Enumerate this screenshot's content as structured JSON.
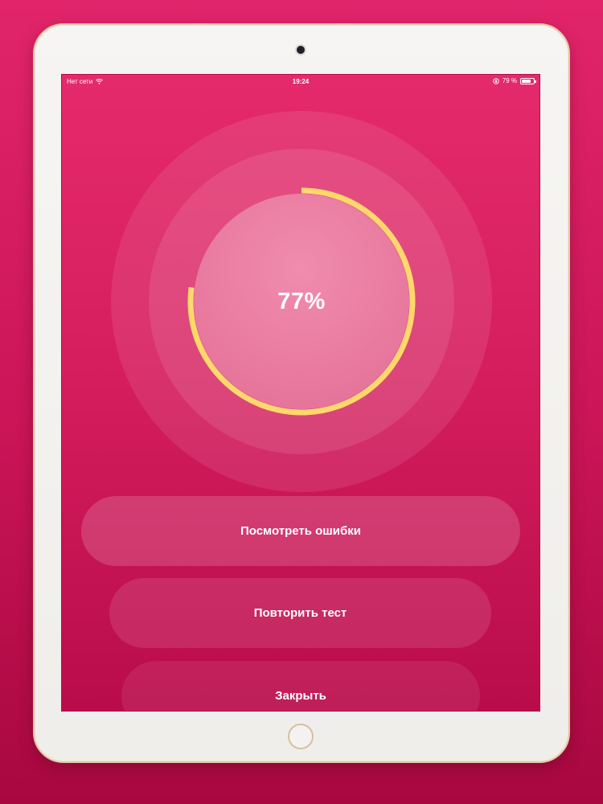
{
  "status_bar": {
    "carrier": "Нет сети",
    "time": "19:24",
    "battery_text": "79 %",
    "battery_level": 0.79,
    "icons": [
      "wifi-icon",
      "orientation-lock-icon",
      "battery-icon"
    ]
  },
  "result": {
    "percent_label": "77%",
    "progress": 0.77,
    "ring_color": "#ffd86b"
  },
  "actions": {
    "review_errors": "Посмотреть ошибки",
    "retry_test": "Повторить тест",
    "close": "Закрыть"
  },
  "colors": {
    "background": "#d61e5e",
    "accent": "#ffd86b",
    "text": "#ffffff"
  }
}
